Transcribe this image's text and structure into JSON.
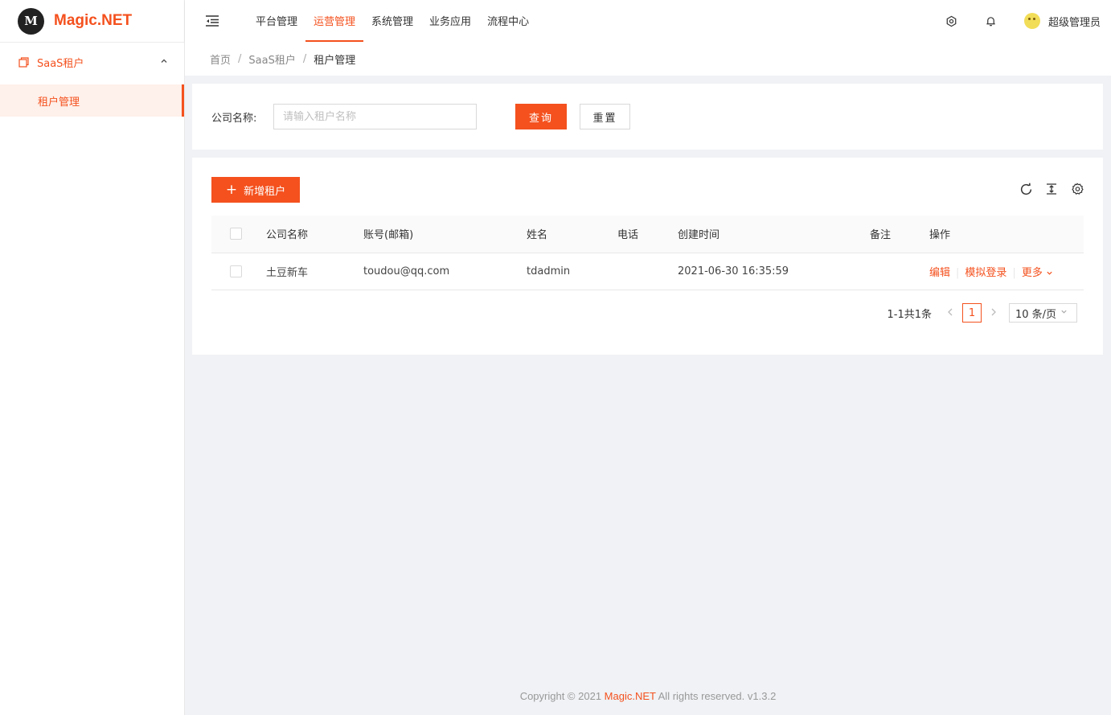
{
  "app": {
    "logo_mark": "M",
    "logo_text": "Magic.NET"
  },
  "sidebar": {
    "group": {
      "label": "SaaS租户",
      "icon": "tenant-icon",
      "expanded": true
    },
    "items": [
      {
        "label": "租户管理",
        "active": true
      }
    ]
  },
  "topnav": {
    "items": [
      {
        "label": "平台管理"
      },
      {
        "label": "运营管理",
        "active": true
      },
      {
        "label": "系统管理"
      },
      {
        "label": "业务应用"
      },
      {
        "label": "流程中心"
      }
    ],
    "username": "超级管理员"
  },
  "breadcrumb": {
    "items": [
      "首页",
      "SaaS租户",
      "租户管理"
    ],
    "separator": "/"
  },
  "search": {
    "label": "公司名称:",
    "placeholder": "请输入租户名称",
    "value": "",
    "query_label": "查询",
    "reset_label": "重置"
  },
  "toolbar": {
    "add_label": "新增租户",
    "add_icon": "plus-icon"
  },
  "table": {
    "columns": [
      "公司名称",
      "账号(邮箱)",
      "姓名",
      "电话",
      "创建时间",
      "备注",
      "操作"
    ],
    "rows": [
      {
        "company": "土豆新车",
        "account": "toudou@qq.com",
        "name": "tdadmin",
        "phone": "",
        "created": "2021-06-30 16:35:59",
        "remark": "",
        "actions": {
          "edit": "编辑",
          "impersonate": "模拟登录",
          "more": "更多"
        }
      }
    ]
  },
  "pagination": {
    "total_text": "1-1共1条",
    "current_page": "1",
    "page_size": "10 条/页"
  },
  "footer": {
    "prefix": "Copyright © 2021 ",
    "brand": "Magic.NET",
    "suffix": " All rights reserved. v1.3.2"
  },
  "colors": {
    "accent": "#f4511e",
    "background": "#f0f2f5"
  }
}
